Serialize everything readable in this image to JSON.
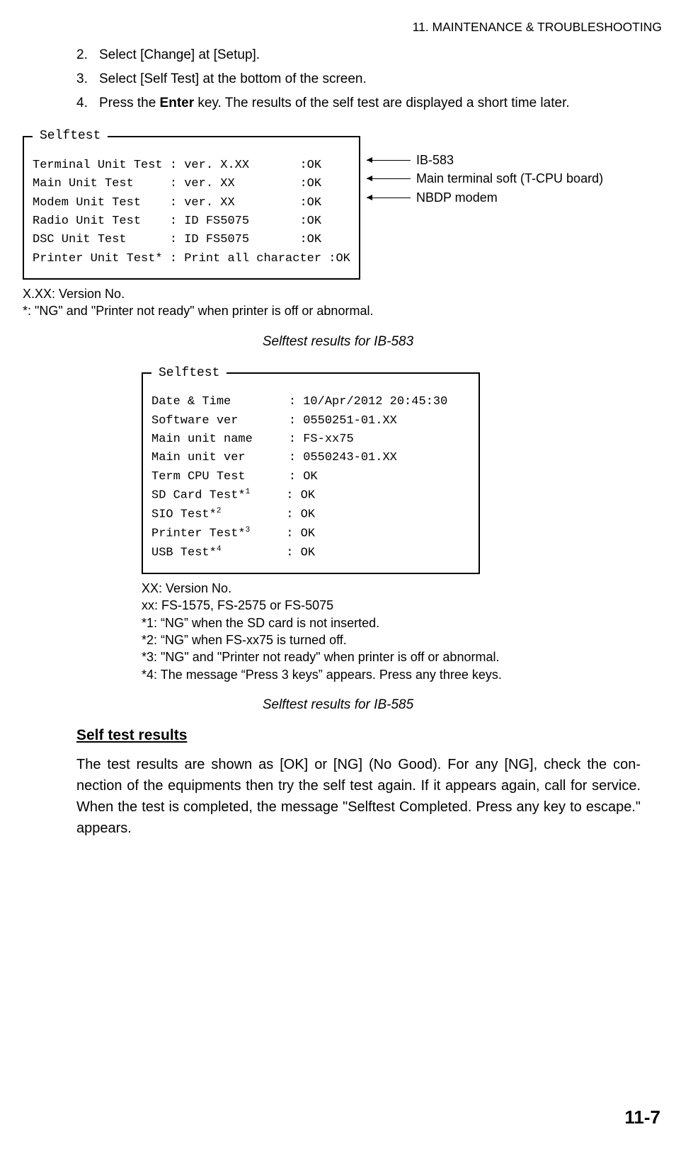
{
  "header": "11.  MAINTENANCE & TROUBLESHOOTING",
  "steps": {
    "s2num": "2.",
    "s2": "Select [Change] at [Setup].",
    "s3num": "3.",
    "s3": "Select [Self Test] at the bottom of the screen.",
    "s4num": "4.",
    "s4a": "Press the ",
    "s4b": "Enter",
    "s4c": " key. The results of the self test are displayed a short time later."
  },
  "fig1": {
    "legend": "Selftest",
    "r1": "Terminal Unit Test : ver. X.XX       :OK",
    "r2": "Main Unit Test     : ver. XX         :OK",
    "r3": "Modem Unit Test    : ver. XX         :OK",
    "r4": "Radio Unit Test    : ID FS5075       :OK",
    "r5": "DSC Unit Test      : ID FS5075       :OK",
    "r6": "Printer Unit Test* : Print all character :OK"
  },
  "annot": {
    "a1": "IB-583",
    "a2": "Main terminal soft (T-CPU board)",
    "a3": "NBDP modem"
  },
  "note1": {
    "l1": "X.XX: Version No.",
    "l2": "*: \"NG\"  and \"Printer not ready\" when printer is off or abnormal."
  },
  "caption1": "Selftest results for IB-583",
  "fig2": {
    "legend": "Selftest",
    "r1": "Date & Time        : 10/Apr/2012 20:45:30",
    "r2": "Software ver       : 0550251-01.XX",
    "r3": "Main unit name     : FS-xx75",
    "r4": "Main unit ver      : 0550243-01.XX",
    "r5": "Term CPU Test      : OK",
    "r6a": "SD Card Test*",
    "r6s": "1",
    "r6b": "     : OK",
    "r7a": "SIO Test*",
    "r7s": "2",
    "r7b": "         : OK",
    "r8a": "Printer Test*",
    "r8s": "3",
    "r8b": "     : OK",
    "r9a": "USB Test*",
    "r9s": "4",
    "r9b": "         : OK"
  },
  "note2": {
    "l1": "XX: Version No.",
    "l2": "xx: FS-1575, FS-2575 or FS-5075",
    "l3": "*1: “NG” when the SD card is not inserted.",
    "l4": "*2: “NG” when FS-xx75 is turned off.",
    "l5": "*3: \"NG\"  and \"Printer not ready\" when printer is off or abnormal.",
    "l6": "*4: The message “Press 3 keys” appears. Press any three keys."
  },
  "caption2": "Selftest results for IB-585",
  "subhead": "Self test results",
  "body": "The test results are shown as [OK] or [NG] (No Good). For any [NG], check the con­nection of the equipments then try the self test again. If it appears again, call for ser­vice. When the test is completed, the message \"Selftest Completed. Press any key to escape.\" appears.",
  "pagenum": "11-7"
}
